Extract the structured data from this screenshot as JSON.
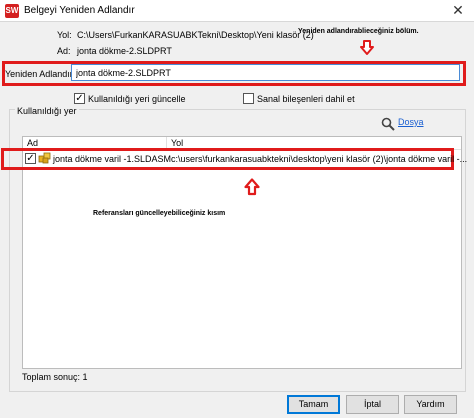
{
  "window": {
    "title": "Belgeyi Yeniden Adlandır",
    "app_icon_text": "SW",
    "close_icon": "close-icon"
  },
  "hints": {
    "rename_section": "Yeniden adlandırablieceğiniz bölüm.",
    "references_section": "Referansları güncelleyebiliceğiniz kısım"
  },
  "fields": {
    "path_label": "Yol:",
    "path_value": "C:\\Users\\FurkanKARASUABKTekni\\Desktop\\Yeni klasör (2)",
    "name_label": "Ad:",
    "name_value": "jonta dökme-2.SLDPRT",
    "rename_label": "Yeniden Adlandır:",
    "rename_input_value": "jonta dökme-2.SLDPRT"
  },
  "options": {
    "update_used_where_label": "Kullanıldığı yeri güncelle",
    "update_used_where_checked": "✓",
    "include_virtual_label": "Sanal bileşenleri dahil et",
    "include_virtual_checked": ""
  },
  "group": {
    "title": "Kullanıldığı yer",
    "search_link": "Dosya"
  },
  "table": {
    "columns": [
      "Ad",
      "Yol"
    ],
    "rows": [
      {
        "checked": "✓",
        "name": "jonta dökme  varil -1.SLDASM",
        "path": "c:\\users\\furkankarasuabktekni\\desktop\\yeni klasör (2)\\jonta dökme  varil -..."
      }
    ]
  },
  "status": {
    "total_results": "Toplam sonuç: 1"
  },
  "buttons": {
    "ok": "Tamam",
    "cancel": "İptal",
    "help": "Yardım"
  },
  "colors": {
    "highlight": "#e01b1b",
    "link": "#1a5fd1",
    "focus": "#0078d7"
  }
}
